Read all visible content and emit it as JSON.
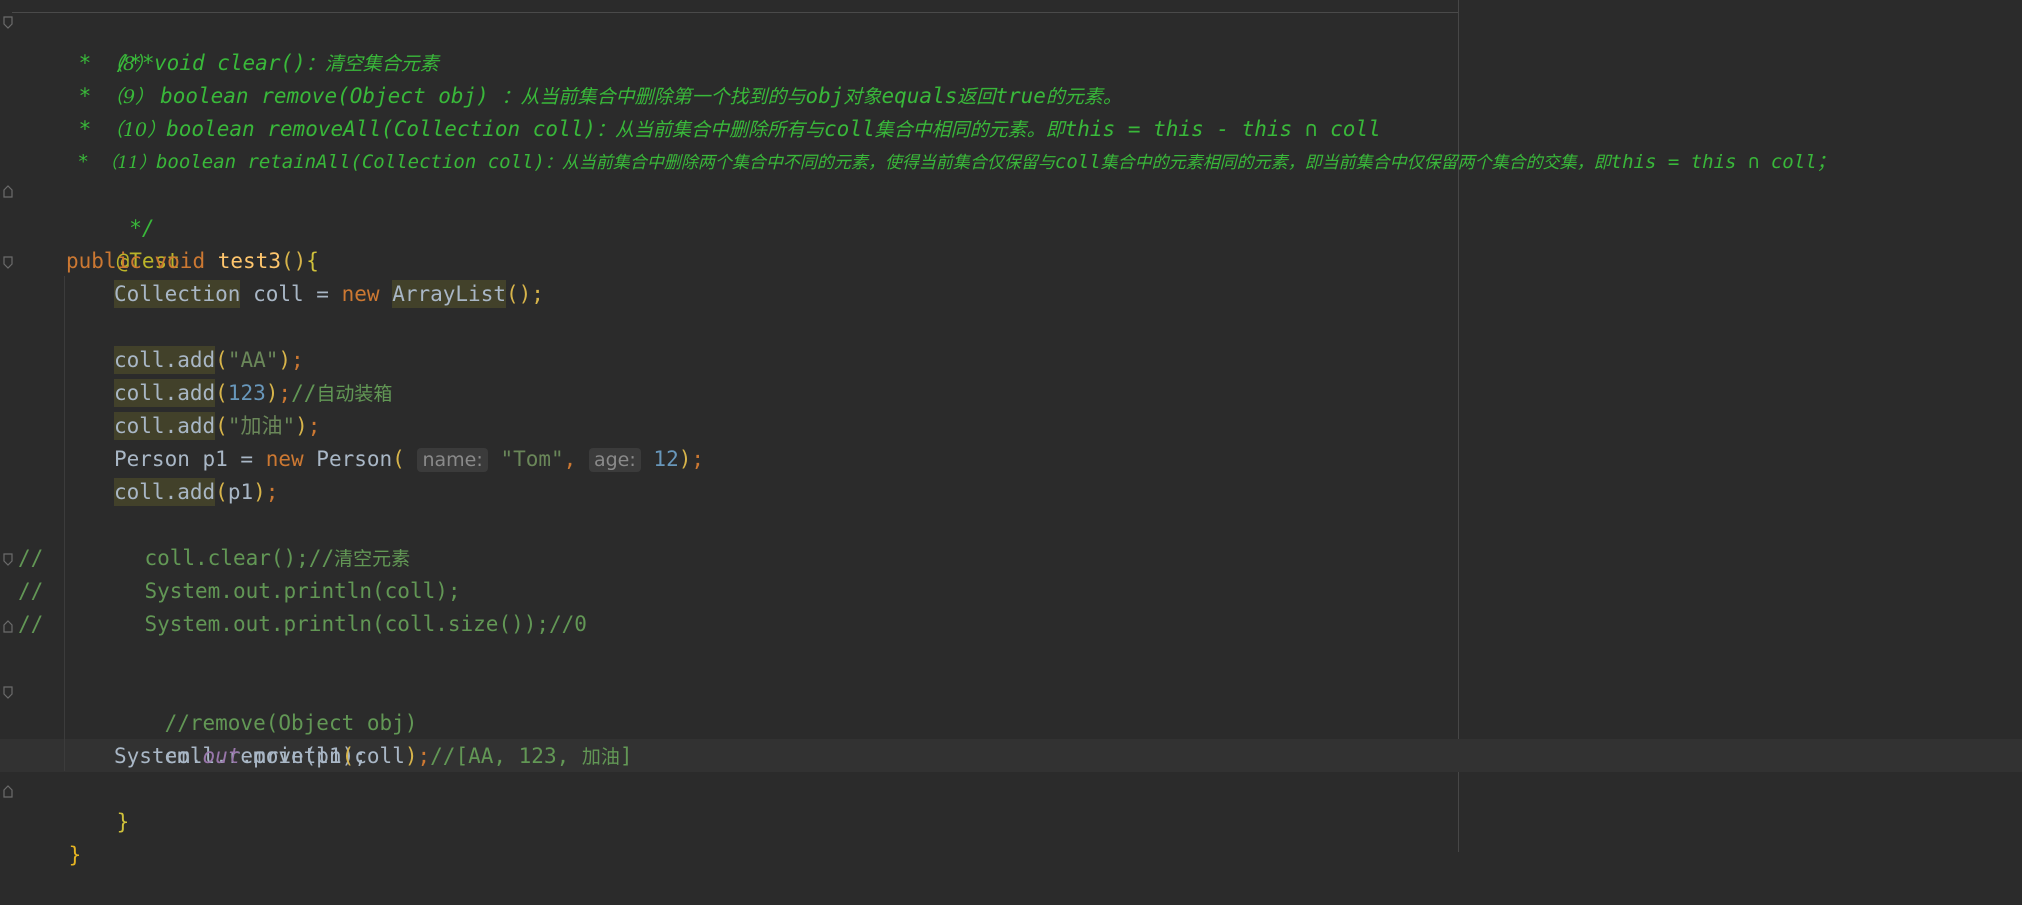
{
  "editor": {
    "language": "java",
    "lines": {
      "l1": {
        "text": "/**"
      },
      "l2": {
        "prefix": " * ",
        "num": "（8）",
        "code": "void clear()",
        "sep": "：",
        "desc": "清空集合元素"
      },
      "l3": {
        "prefix": " * ",
        "num": "（9） ",
        "code": "boolean remove(Object obj) ",
        "sep": "：",
        "desc_a": "从当前集合中删除第一个找到的与",
        "desc_b": "obj",
        "desc_c": "对象",
        "desc_d": "equals",
        "desc_e": "返回",
        "desc_f": "true",
        "desc_g": "的元素。"
      },
      "l4": {
        "prefix": " * ",
        "num": "（10）",
        "code": "boolean removeAll(Collection coll)",
        "sep": "：",
        "desc_a": "从当前集合中删除所有与",
        "desc_b": "coll",
        "desc_c": "集合中相同的元素。即",
        "desc_d": "this = this - this ∩ coll"
      },
      "l5": {
        "prefix": " * ",
        "num": "（11）",
        "code": "boolean retainAll(Collection coll)",
        "sep": "：",
        "desc_a": "从当前集合中删除两个集合中不同的元素，使得当前集合仅保留与",
        "desc_b": "coll",
        "desc_c": "集合中的元素相同的元素，即当前集合中仅保留两个集合的交集，即",
        "desc_d": "this = this ∩ coll；"
      },
      "l6": {
        "text": " */"
      },
      "l7": {
        "text": "@Test"
      },
      "l8": {
        "kw1": "public",
        "kw2": "void",
        "name": "test3",
        "paren": "()",
        "brace": "{"
      },
      "l9": {
        "type1": "Collection",
        "var": " coll = ",
        "kw": "new",
        "type2": "ArrayList",
        "end": "();"
      },
      "l11": {
        "call": "coll.add",
        "open": "(",
        "arg": "\"AA\"",
        "close": ")",
        "end": ";"
      },
      "l12": {
        "call": "coll.add",
        "open": "(",
        "arg": "123",
        "close": ")",
        "end": ";",
        "comment": "//",
        "comment_cjk": "自动装箱"
      },
      "l13": {
        "call": "coll.add",
        "open": "(",
        "arg": "\"加油\"",
        "close": ")",
        "end": ";"
      },
      "l14": {
        "decl": "Person p1 = ",
        "kw": "new",
        "type": " Person",
        "open": "(",
        "hint1": "name:",
        "arg1": "\"Tom\"",
        "comma": ",",
        "hint2": "age:",
        "arg2": "12",
        "close": ")",
        "end": ";"
      },
      "l15": {
        "call": "coll.add",
        "open": "(",
        "arg": "p1",
        "close": ")",
        "end": ";"
      },
      "l17": {
        "slashes": "//",
        "code": "        coll.clear();//",
        "cjk": "清空元素"
      },
      "l18": {
        "slashes": "//",
        "code": "        System.out.println(coll);"
      },
      "l19": {
        "slashes": "//",
        "code": "        System.out.println(coll.size());//0"
      },
      "l21": {
        "text": "//remove(Object obj)"
      },
      "l22": {
        "text": "coll.remove(p1);"
      },
      "l23": {
        "obj": "System.",
        "field": "out",
        "call": ".println",
        "open": "(",
        "arg": "coll",
        "close": ")",
        "end": ";",
        "comment": "//[AA, 123, ",
        "comment_cjk": "加油",
        "comment_end": "]"
      },
      "l24": {
        "text": "}"
      },
      "l25": {
        "text": "}"
      }
    }
  }
}
